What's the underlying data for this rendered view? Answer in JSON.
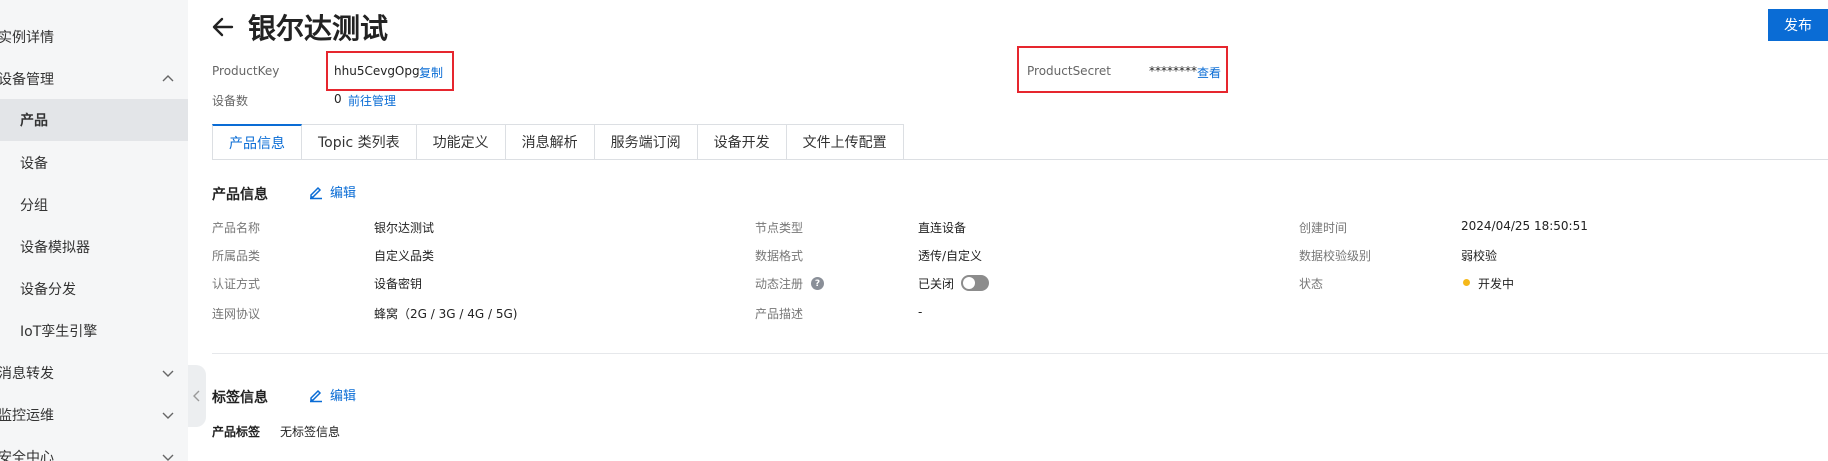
{
  "sidebar": {
    "items": [
      {
        "label": "实例详情"
      },
      {
        "label": "设备管理"
      },
      {
        "label": "产品"
      },
      {
        "label": "设备"
      },
      {
        "label": "分组"
      },
      {
        "label": "设备模拟器"
      },
      {
        "label": "设备分发"
      },
      {
        "label": "IoT孪生引擎"
      },
      {
        "label": "消息转发"
      },
      {
        "label": "监控运维"
      },
      {
        "label": "安全中心"
      }
    ],
    "active": "产品"
  },
  "header": {
    "title": "银尔达测试",
    "publish_label": "发布"
  },
  "meta": {
    "product_key_label": "ProductKey",
    "product_key_value": "hhu5CevgOpg",
    "copy_label": "复制",
    "device_count_label": "设备数",
    "device_count_value": "0",
    "goto_manage_label": "前往管理",
    "product_secret_label": "ProductSecret",
    "product_secret_value": "********",
    "view_label": "查看"
  },
  "tabs": [
    {
      "label": "产品信息"
    },
    {
      "label": "Topic 类列表"
    },
    {
      "label": "功能定义"
    },
    {
      "label": "消息解析"
    },
    {
      "label": "服务端订阅"
    },
    {
      "label": "设备开发"
    },
    {
      "label": "文件上传配置"
    }
  ],
  "product_info": {
    "title": "产品信息",
    "edit_label": "编辑",
    "fields": {
      "name_label": "产品名称",
      "name_value": "银尔达测试",
      "category_label": "所属品类",
      "category_value": "自定义品类",
      "auth_label": "认证方式",
      "auth_value": "设备密钥",
      "protocol_label": "连网协议",
      "protocol_value": "蜂窝（2G / 3G / 4G / 5G)",
      "node_label": "节点类型",
      "node_value": "直连设备",
      "format_label": "数据格式",
      "format_value": "透传/自定义",
      "dynamic_label": "动态注册",
      "dynamic_value": "已关闭",
      "desc_label": "产品描述",
      "desc_value": "-",
      "created_label": "创建时间",
      "created_value": "2024/04/25 18:50:51",
      "check_label": "数据校验级别",
      "check_value": "弱校验",
      "status_label": "状态",
      "status_value": "开发中"
    },
    "dynamic_enabled": false,
    "status_color": "#f5b81a"
  },
  "tag_info": {
    "title": "标签信息",
    "edit_label": "编辑",
    "tag_label": "产品标签",
    "tag_value": "无标签信息"
  },
  "colors": {
    "accent": "#0a6cd5",
    "highlight_box": "#e6262e"
  }
}
